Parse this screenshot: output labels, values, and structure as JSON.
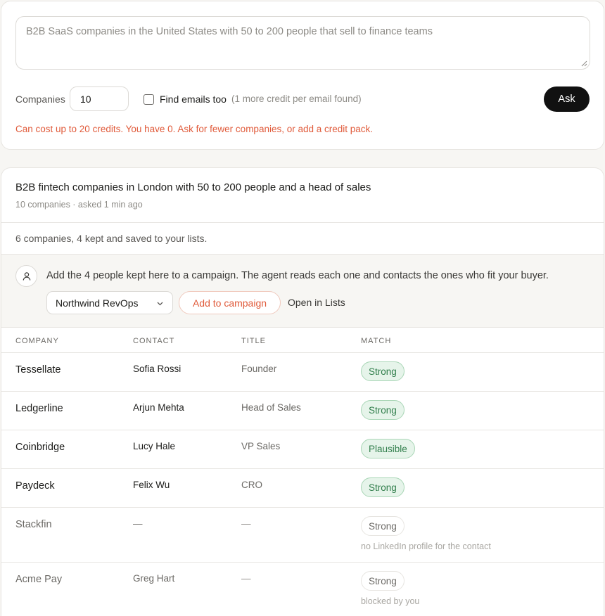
{
  "query": {
    "placeholder": "B2B SaaS companies in the United States with 50 to 200 people that sell to finance teams",
    "companies_label": "Companies",
    "companies_value": "10",
    "find_emails_label": "Find emails too",
    "find_emails_checked": false,
    "find_emails_note": "(1 more credit per email found)",
    "ask_label": "Ask",
    "cost_warning": "Can cost up to 20 credits. You have 0. Ask for fewer companies, or add a credit pack."
  },
  "result": {
    "title": "B2B fintech companies in London with 50 to 200 people and a head of sales",
    "meta": "10 companies · asked 1 min ago",
    "summary": "6 companies, 4 kept and saved to your lists.",
    "campaign": {
      "text": "Add the 4 people kept here to a campaign. The agent reads each one and contacts the ones who fit your buyer.",
      "selected": "Northwind RevOps",
      "add_label": "Add to campaign",
      "open_label": "Open in Lists"
    },
    "columns": [
      "COMPANY",
      "CONTACT",
      "TITLE",
      "MATCH"
    ],
    "rows": [
      {
        "company": "Tessellate",
        "contact": "Sofia Rossi",
        "title": "Founder",
        "match": "Strong",
        "kept": true,
        "note": ""
      },
      {
        "company": "Ledgerline",
        "contact": "Arjun Mehta",
        "title": "Head of Sales",
        "match": "Strong",
        "kept": true,
        "note": ""
      },
      {
        "company": "Coinbridge",
        "contact": "Lucy Hale",
        "title": "VP Sales",
        "match": "Plausible",
        "kept": true,
        "note": ""
      },
      {
        "company": "Paydeck",
        "contact": "Felix Wu",
        "title": "CRO",
        "match": "Strong",
        "kept": true,
        "note": ""
      },
      {
        "company": "Stackfin",
        "contact": "—",
        "title": "—",
        "match": "Strong",
        "kept": false,
        "note": "no LinkedIn profile for the contact"
      },
      {
        "company": "Acme Pay",
        "contact": "Greg Hart",
        "title": "—",
        "match": "Strong",
        "kept": false,
        "note": "blocked by you"
      }
    ]
  },
  "colors": {
    "accent": "#e05a3a",
    "match_good_bg": "#e6f4ea",
    "match_good_text": "#2f7d4a"
  }
}
